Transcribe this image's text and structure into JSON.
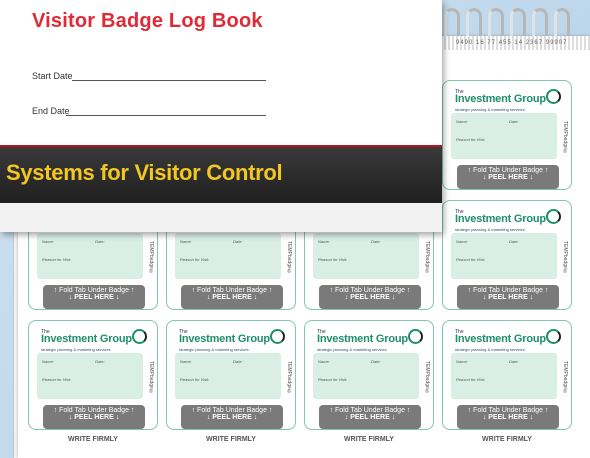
{
  "cover": {
    "title": "Visitor Badge Log Book",
    "start_date_label": "Start Date",
    "end_date_label": "End Date",
    "slogan": "Systems for Visitor Control"
  },
  "sheet": {
    "barcode_text": "9490  16  77  455  14  2367  99907"
  },
  "badge": {
    "logo_the": "The",
    "logo_name": "Investment Group",
    "logo_tagline": "strategic planning & marketing services",
    "name_label": "Name:",
    "date_label": "Date:",
    "reason_label": "Reason for Visit:",
    "side_text": "TEMPbadge®",
    "tab_line1": "↑ Fold Tab Under Badge ↑",
    "tab_line2": "↓ PEEL HERE ↓",
    "write_firmly": "WRITE FIRMLY"
  },
  "colors": {
    "title_red": "#e12a35",
    "slogan_yellow": "#f3c623",
    "badge_green": "#1f8f6a",
    "field_tint": "#d9efe6"
  }
}
